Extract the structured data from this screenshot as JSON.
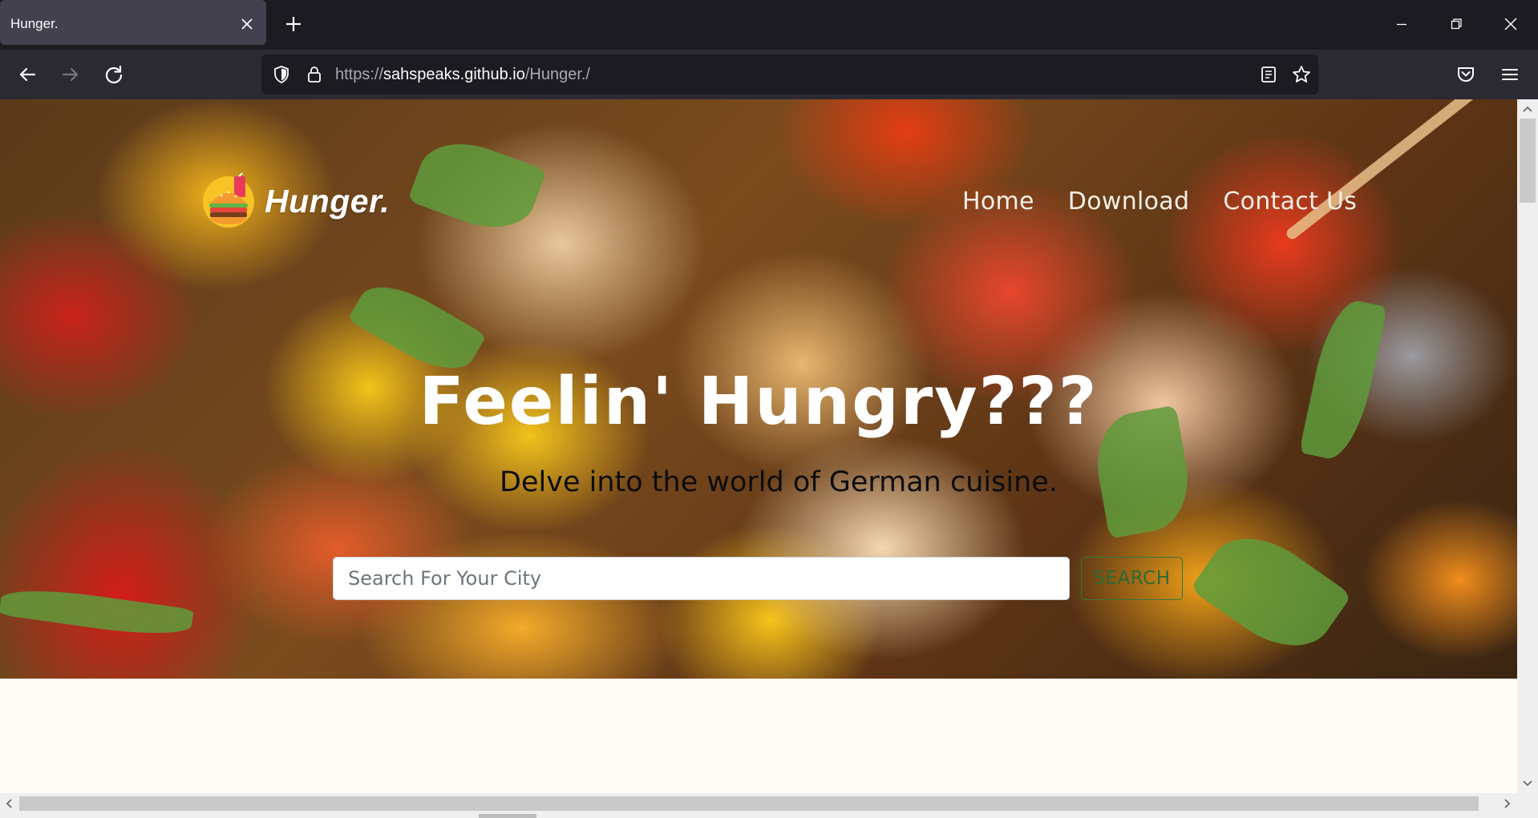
{
  "browser": {
    "tab_title": "Hunger.",
    "url_prefix": "https://",
    "url_host": "sahspeaks.github.io",
    "url_path": "/Hunger./"
  },
  "site": {
    "brand": "Hunger.",
    "nav": [
      "Home",
      "Download",
      "Contact Us"
    ],
    "headline": "Feelin' Hungry???",
    "subline": "Delve into the world of German cuisine.",
    "search_placeholder": "Search For Your City",
    "search_button": "SEARCH"
  },
  "colors": {
    "browser_chrome": "#1c1b22",
    "toolbar": "#2b2a33",
    "search_button_border": "#2d7a3f",
    "page_background": "#fffcf6"
  },
  "icons": {
    "tab_close": "close-icon",
    "new_tab": "plus-icon",
    "back": "arrow-left-icon",
    "forward": "arrow-right-icon",
    "reload": "reload-icon",
    "tracking": "shield-icon",
    "lock": "lock-icon",
    "reader": "reader-view-icon",
    "bookmark": "star-icon",
    "pocket": "pocket-icon",
    "menu": "hamburger-menu-icon"
  }
}
